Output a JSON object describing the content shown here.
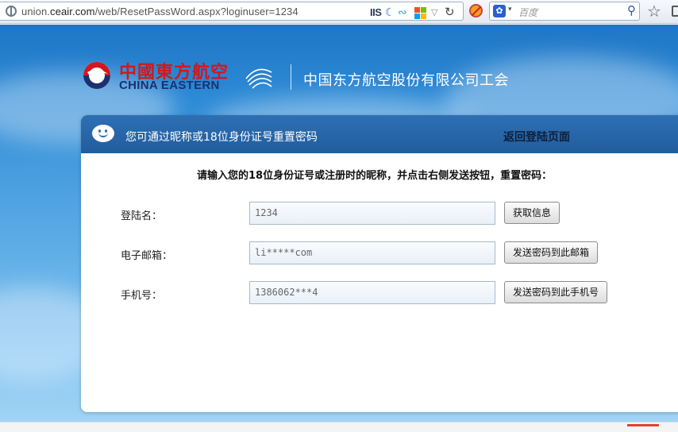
{
  "browser": {
    "url_prefix": "union.",
    "url_domain": "ceair.com",
    "url_path": "/web/ResetPassWord.aspx?loginuser=1234",
    "iis_label": "IIS",
    "search_placeholder": "百度"
  },
  "header": {
    "logo_cn": "中國東方航空",
    "logo_en": "CHINA EASTERN",
    "org_name": "中国东方航空股份有限公司工会"
  },
  "card": {
    "head_text": "您可通过昵称或18位身份证号重置密码",
    "back_link": "返回登陆页面",
    "instruction": "请输入您的18位身份证号或注册时的昵称，并点击右侧发送按钮，重置密码："
  },
  "form": {
    "login": {
      "label": "登陆名：",
      "value": "1234",
      "button": "获取信息"
    },
    "email": {
      "label": "电子邮箱：",
      "value": "li*****com",
      "button": "发送密码到此邮箱"
    },
    "phone": {
      "label": "手机号：",
      "value": "1386062***4",
      "button": "发送密码到此手机号"
    }
  },
  "colors": {
    "brand_red": "#d4161d",
    "brand_navy": "#1d2f6e",
    "card_header": "#2e6fb3"
  }
}
